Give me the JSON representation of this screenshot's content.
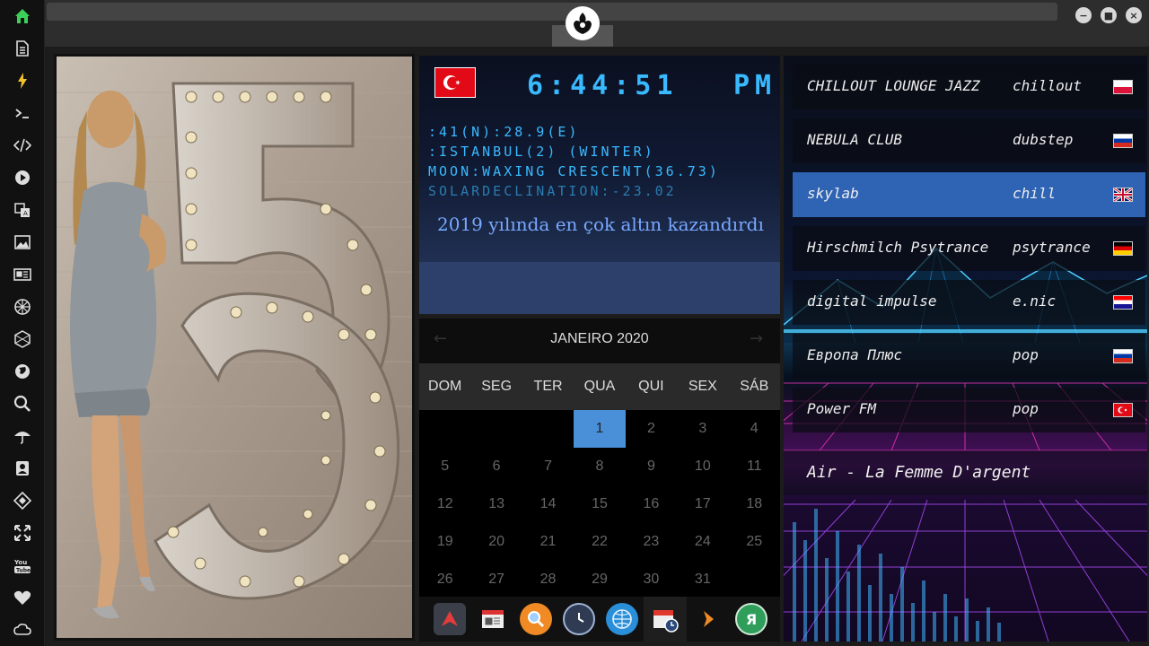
{
  "clock": {
    "time": "6:44:51",
    "ampm": "PM",
    "coords": ":41(N):28.9(E)",
    "location": ":ISTANBUL(2) (WINTER)",
    "moon": "MOON:WAXING CRESCENT(36.73)",
    "solar": "SOLARDECLINATION:-23.02",
    "news": "2019 yılında en çok altın kazandırdı"
  },
  "calendar": {
    "month": "JANEIRO 2020",
    "prev_arrow": "←",
    "next_arrow": "→",
    "day_names": [
      "DOM",
      "SEG",
      "TER",
      "QUA",
      "QUI",
      "SEX",
      "SÁB"
    ],
    "weeks": [
      [
        "",
        "",
        "",
        "1",
        "2",
        "3",
        "4"
      ],
      [
        "5",
        "6",
        "7",
        "8",
        "9",
        "10",
        "11"
      ],
      [
        "12",
        "13",
        "14",
        "15",
        "16",
        "17",
        "18"
      ],
      [
        "19",
        "20",
        "21",
        "22",
        "23",
        "24",
        "25"
      ],
      [
        "26",
        "27",
        "28",
        "29",
        "30",
        "31",
        ""
      ]
    ],
    "today": "1"
  },
  "radio": {
    "stations": [
      {
        "name": "CHILLOUT LOUNGE JAZZ",
        "genre": "chillout",
        "flag": "poland"
      },
      {
        "name": "NEBULA CLUB",
        "genre": "dubstep",
        "flag": "russia"
      },
      {
        "name": "skylab",
        "genre": "chill",
        "flag": "uk"
      },
      {
        "name": "Hirschmilch Psytrance",
        "genre": "psytrance",
        "flag": "germany"
      },
      {
        "name": "digital impulse",
        "genre": "e.nic",
        "flag": "croatia"
      },
      {
        "name": "Европа Плюс",
        "genre": "pop",
        "flag": "russia"
      },
      {
        "name": "Power FM",
        "genre": "pop",
        "flag": "turkey"
      }
    ],
    "active_index": 2,
    "now_playing": "Air - La Femme D'argent"
  },
  "sidebar": {
    "icons": [
      "home-icon",
      "document-icon",
      "lightning-icon",
      "terminal-icon",
      "code-icon",
      "play-icon",
      "translate-icon",
      "image-icon",
      "news-icon",
      "aperture-icon",
      "hexagon-icon",
      "globe-icon",
      "search-icon",
      "umbrella-icon",
      "contact-icon",
      "tag-icon",
      "fullscreen-icon",
      "youtube-icon",
      "heart-icon",
      "cloud-icon"
    ]
  },
  "dock": {
    "items": [
      "arrow-app-icon",
      "calendar-news-icon",
      "magnifier-icon",
      "clock-icon",
      "globe-icon",
      "calendar-clock-icon",
      "chevron-icon",
      "yandex-icon"
    ],
    "yandex_label": "Я"
  },
  "window": {
    "minimize": "−",
    "maximize": "■",
    "close": "×"
  },
  "colors": {
    "accent": "#4a90d9",
    "digital": "#39b9ff",
    "active_station": "#2f63b4",
    "home_icon": "#3ecf5a",
    "lightning_icon": "#f2c12e"
  }
}
